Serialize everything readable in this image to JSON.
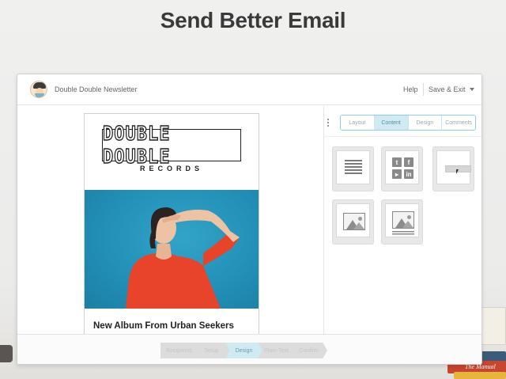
{
  "hero": {
    "title": "Send Better Email"
  },
  "app": {
    "title": "Double Double Newsletter",
    "help_label": "Help",
    "save_exit_label": "Save & Exit"
  },
  "email": {
    "brand_name": "DOUBLE DOUBLE",
    "brand_sub": "RECORDS",
    "headline": "New Album From Urban Seekers"
  },
  "tabs": [
    {
      "label": "Layout",
      "active": false
    },
    {
      "label": "Content",
      "active": true
    },
    {
      "label": "Design",
      "active": false
    },
    {
      "label": "Comments",
      "active": false
    }
  ],
  "content_blocks": [
    {
      "icon": "text-block-icon"
    },
    {
      "icon": "social-block-icon"
    },
    {
      "icon": "button-block-icon"
    },
    {
      "icon": "image-block-icon"
    },
    {
      "icon": "image-caption-block-icon"
    }
  ],
  "steps": [
    {
      "label": "Recipients",
      "active": false
    },
    {
      "label": "Setup",
      "active": false
    },
    {
      "label": "Design",
      "active": true
    },
    {
      "label": "Plain-Text",
      "active": false
    },
    {
      "label": "Confirm",
      "active": false
    }
  ],
  "book_text": "The Manual",
  "colors": {
    "accent": "#cfeaf2",
    "accent_border": "#8bd0e0",
    "photo_bg": "#2290b8",
    "shirt": "#e8442a"
  }
}
